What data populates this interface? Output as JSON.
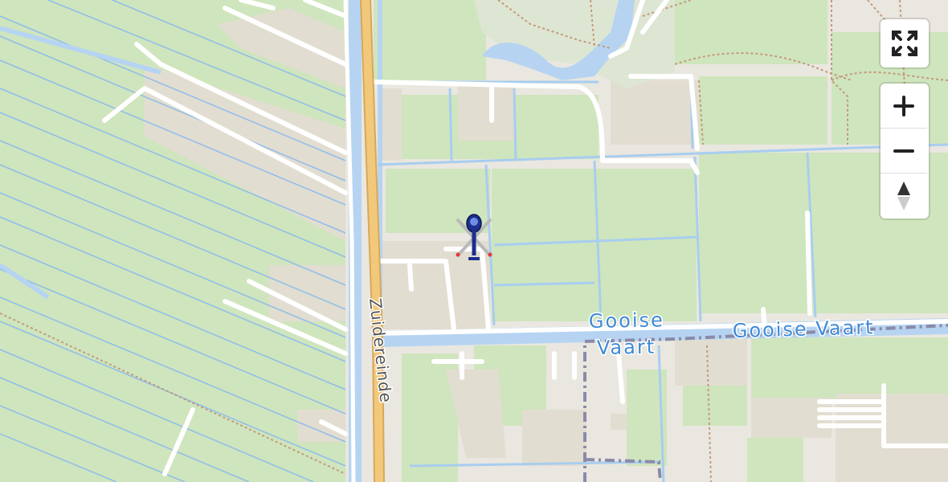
{
  "map": {
    "water_labels": [
      "Gooise",
      "Vaart",
      "Gooise Vaart"
    ],
    "road_labels": [
      "Zuidereinde"
    ],
    "colors": {
      "grass": "#cfe5bd",
      "water": "#b6d4f2",
      "waterway": "#8fbdea",
      "road": "#ffffff",
      "main_road": "#f2c97a",
      "boundary": "#8a8aa8",
      "path": "#c49a7a",
      "built": "#e4dfd4"
    },
    "marker": {
      "icon": "helicopter-icon"
    }
  },
  "controls": {
    "fullscreen_icon": "fullscreen-icon",
    "zoom_in_icon": "plus-icon",
    "zoom_out_icon": "minus-icon",
    "compass_icon": "compass-icon"
  }
}
